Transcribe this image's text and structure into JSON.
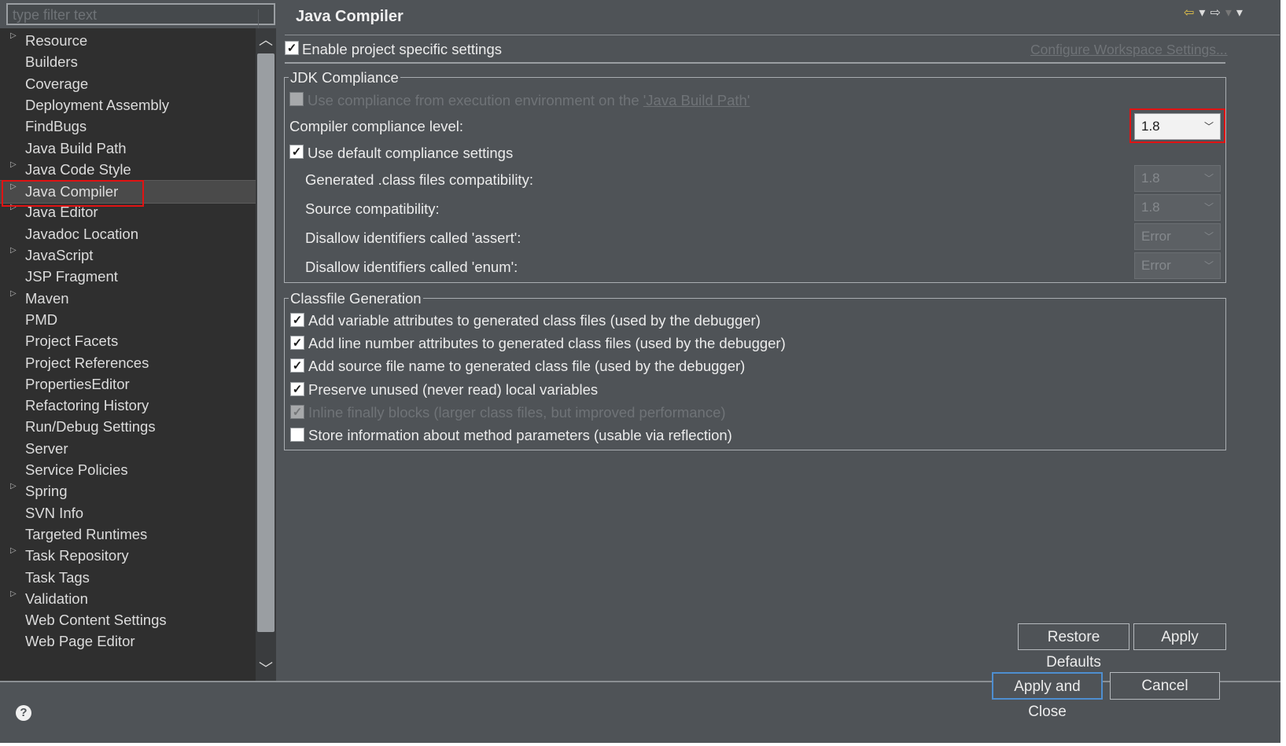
{
  "filter": {
    "placeholder": "type filter text"
  },
  "tree": {
    "items": [
      {
        "label": "Resource",
        "expandable": true
      },
      {
        "label": "Builders",
        "expandable": false
      },
      {
        "label": "Coverage",
        "expandable": false
      },
      {
        "label": "Deployment Assembly",
        "expandable": false
      },
      {
        "label": "FindBugs",
        "expandable": false
      },
      {
        "label": "Java Build Path",
        "expandable": false
      },
      {
        "label": "Java Code Style",
        "expandable": true
      },
      {
        "label": "Java Compiler",
        "expandable": true,
        "selected": true
      },
      {
        "label": "Java Editor",
        "expandable": true
      },
      {
        "label": "Javadoc Location",
        "expandable": false
      },
      {
        "label": "JavaScript",
        "expandable": true
      },
      {
        "label": "JSP Fragment",
        "expandable": false
      },
      {
        "label": "Maven",
        "expandable": true
      },
      {
        "label": "PMD",
        "expandable": false
      },
      {
        "label": "Project Facets",
        "expandable": false
      },
      {
        "label": "Project References",
        "expandable": false
      },
      {
        "label": "PropertiesEditor",
        "expandable": false
      },
      {
        "label": "Refactoring History",
        "expandable": false
      },
      {
        "label": "Run/Debug Settings",
        "expandable": false
      },
      {
        "label": "Server",
        "expandable": false
      },
      {
        "label": "Service Policies",
        "expandable": false
      },
      {
        "label": "Spring",
        "expandable": true
      },
      {
        "label": "SVN Info",
        "expandable": false
      },
      {
        "label": "Targeted Runtimes",
        "expandable": false
      },
      {
        "label": "Task Repository",
        "expandable": true
      },
      {
        "label": "Task Tags",
        "expandable": false
      },
      {
        "label": "Validation",
        "expandable": true
      },
      {
        "label": "Web Content Settings",
        "expandable": false
      },
      {
        "label": "Web Page Editor",
        "expandable": false
      }
    ]
  },
  "page": {
    "title": "Java Compiler",
    "enable_specific": {
      "label": "Enable project specific settings",
      "checked": true
    },
    "configure_workspace_link": "Configure Workspace Settings...",
    "jdk": {
      "group_title": "JDK Compliance",
      "use_ee": {
        "label": "Use compliance from execution environment on the ",
        "link": "'Java Build Path'",
        "checked": false
      },
      "compliance_label": "Compiler compliance level:",
      "compliance_value": "1.8",
      "use_default": {
        "label": "Use default compliance settings",
        "checked": true
      },
      "generated_label": "Generated .class files compatibility:",
      "generated_value": "1.8",
      "source_label": "Source compatibility:",
      "source_value": "1.8",
      "assert_label": "Disallow identifiers called 'assert':",
      "assert_value": "Error",
      "enum_label": "Disallow identifiers called 'enum':",
      "enum_value": "Error"
    },
    "classfile": {
      "group_title": "Classfile Generation",
      "options": [
        {
          "label": "Add variable attributes to generated class files (used by the debugger)",
          "checked": true,
          "disabled": false
        },
        {
          "label": "Add line number attributes to generated class files (used by the debugger)",
          "checked": true,
          "disabled": false
        },
        {
          "label": "Add source file name to generated class file (used by the debugger)",
          "checked": true,
          "disabled": false
        },
        {
          "label": "Preserve unused (never read) local variables",
          "checked": true,
          "disabled": false
        },
        {
          "label": "Inline finally blocks (larger class files, but improved performance)",
          "checked": true,
          "disabled": true
        },
        {
          "label": "Store information about method parameters (usable via reflection)",
          "checked": false,
          "disabled": false
        }
      ]
    },
    "restore_defaults": "Restore Defaults",
    "apply": "Apply"
  },
  "footer": {
    "apply_close": "Apply and Close",
    "cancel": "Cancel"
  },
  "icons": {
    "check": "✓",
    "chevron": "⌄",
    "help": "?"
  },
  "colors": {
    "highlight": "#e01313",
    "dialog_bg": "#4f5357",
    "tree_bg": "#2f2f2f"
  }
}
